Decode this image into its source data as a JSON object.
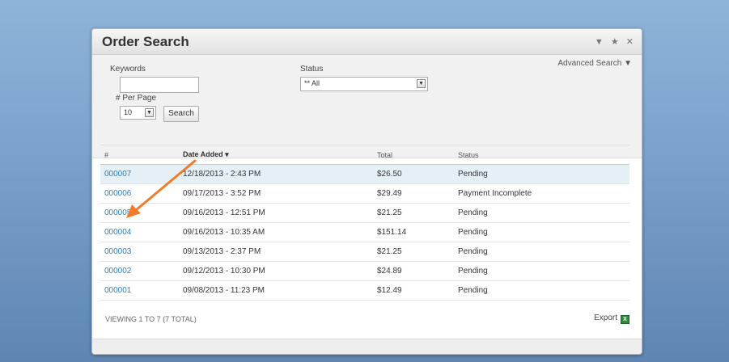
{
  "panel": {
    "title": "Order Search",
    "controls": [
      "▼",
      "★",
      "✕"
    ]
  },
  "filters": {
    "keywords_label": "Keywords",
    "keywords_value": "",
    "status_label": "Status",
    "status_selected": "** All",
    "per_page_label": "# Per Page",
    "per_page_selected": "10",
    "search_button": "Search",
    "advanced_search": "Advanced Search ▼"
  },
  "table": {
    "columns": [
      "#",
      "Date Added ▾",
      "Total",
      "Status"
    ],
    "rows": [
      {
        "id": "000007",
        "date": "12/18/2013 - 2:43 PM",
        "total": "$26.50",
        "status": "Pending"
      },
      {
        "id": "000006",
        "date": "09/17/2013 - 3:52 PM",
        "total": "$29.49",
        "status": "Payment Incomplete"
      },
      {
        "id": "000005",
        "date": "09/16/2013 - 12:51 PM",
        "total": "$21.25",
        "status": "Pending"
      },
      {
        "id": "000004",
        "date": "09/16/2013 - 10:35 AM",
        "total": "$151.14",
        "status": "Pending"
      },
      {
        "id": "000003",
        "date": "09/13/2013 - 2:37 PM",
        "total": "$21.25",
        "status": "Pending"
      },
      {
        "id": "000002",
        "date": "09/12/2013 - 10:30 PM",
        "total": "$24.89",
        "status": "Pending"
      },
      {
        "id": "000001",
        "date": "09/08/2013 - 11:23 PM",
        "total": "$12.49",
        "status": "Pending"
      }
    ]
  },
  "footer": {
    "viewing": "VIEWING 1 TO 7 (7 TOTAL)",
    "export": "Export",
    "export_icon": "excel-icon"
  },
  "annotation": {
    "arrow_color": "#f07d2e"
  }
}
